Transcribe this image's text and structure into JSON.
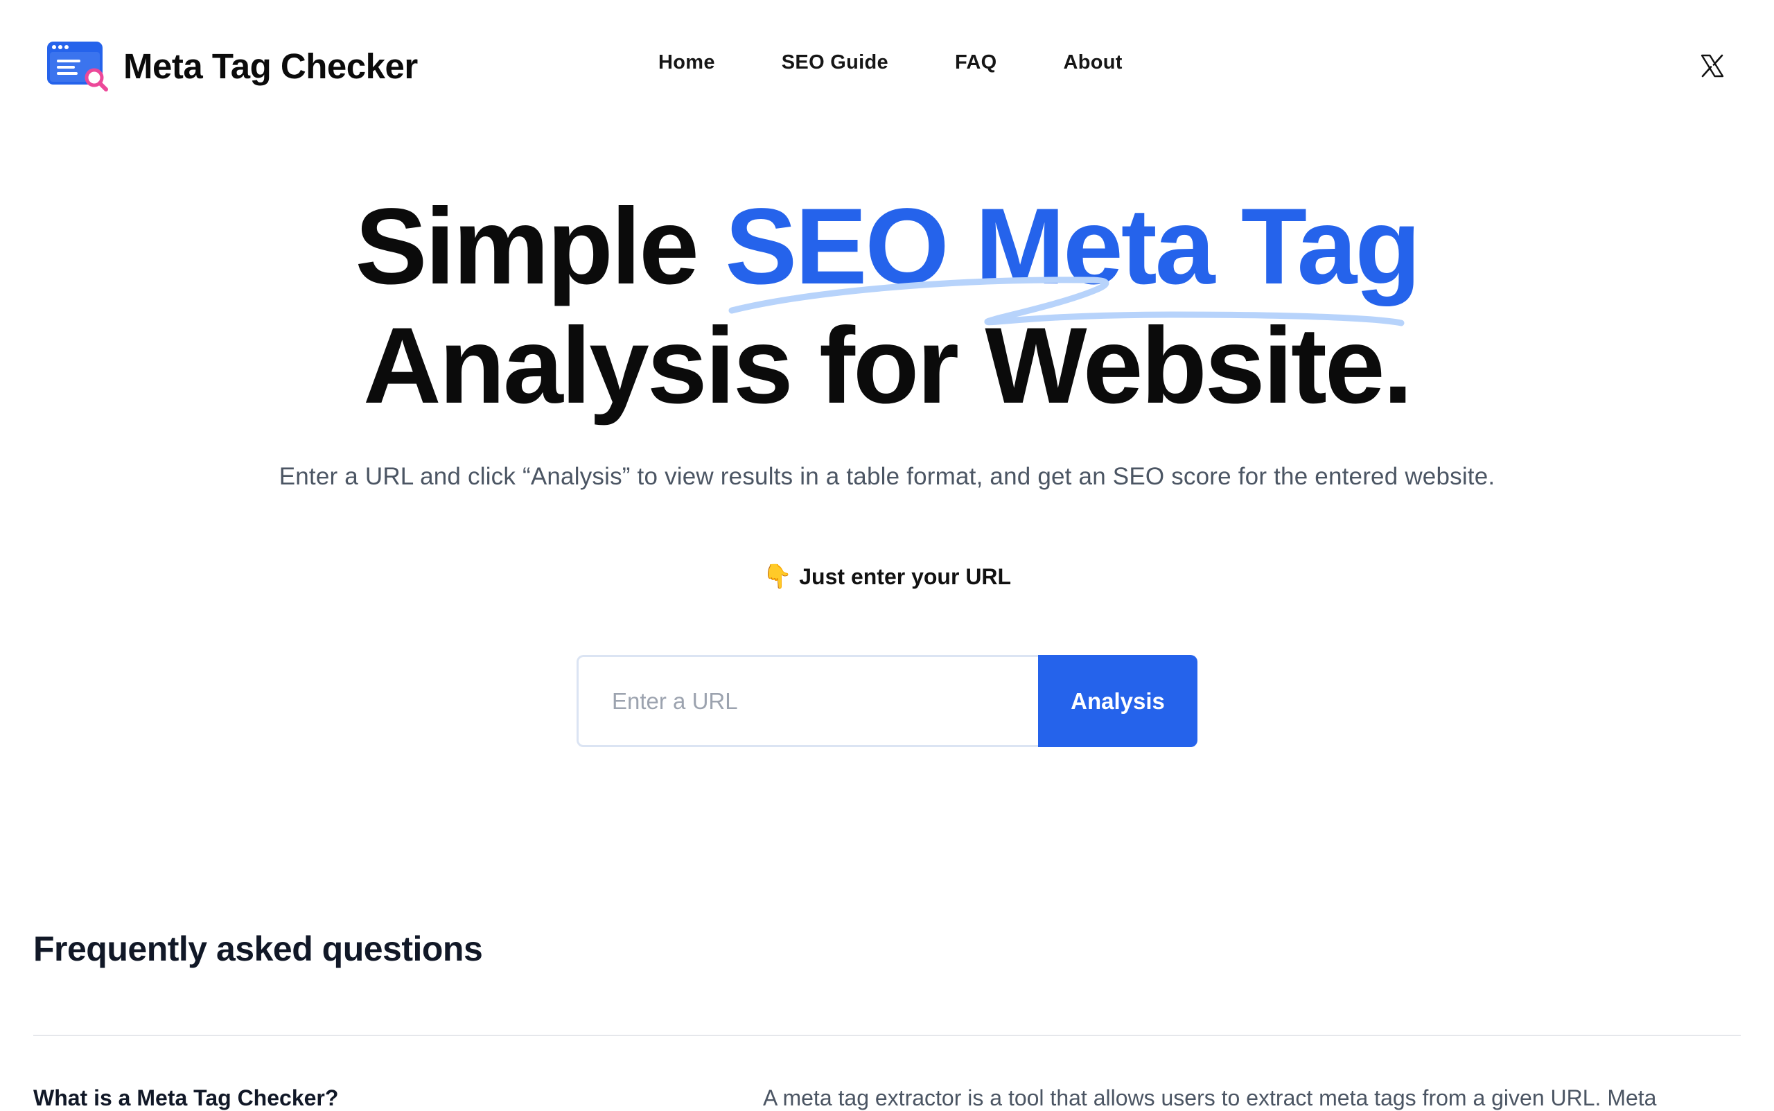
{
  "header": {
    "brand_name": "Meta Tag Checker",
    "nav": [
      {
        "label": "Home"
      },
      {
        "label": "SEO Guide"
      },
      {
        "label": "FAQ"
      },
      {
        "label": "About"
      }
    ],
    "social_icon": "x-logo-icon"
  },
  "hero": {
    "title_part1": "Simple ",
    "title_highlight": "SEO Meta Tag",
    "title_line2": "Analysis for Website.",
    "subtitle": "Enter a URL and click “Analysis” to view results in a table format, and get an SEO score for the entered website.",
    "prompt_emoji": "👇",
    "prompt_text": "Just enter your URL"
  },
  "search": {
    "placeholder": "Enter a URL",
    "value": "",
    "button_label": "Analysis"
  },
  "faq": {
    "heading": "Frequently asked questions",
    "items": [
      {
        "question": "What is a Meta Tag Checker?",
        "answer": "A meta tag extractor is a tool that allows users to extract meta tags from a given URL. Meta"
      }
    ]
  },
  "colors": {
    "accent": "#2563eb",
    "underline": "#b7d3fb",
    "text_dark": "#0b0b0b",
    "text_muted": "#4b5563"
  }
}
